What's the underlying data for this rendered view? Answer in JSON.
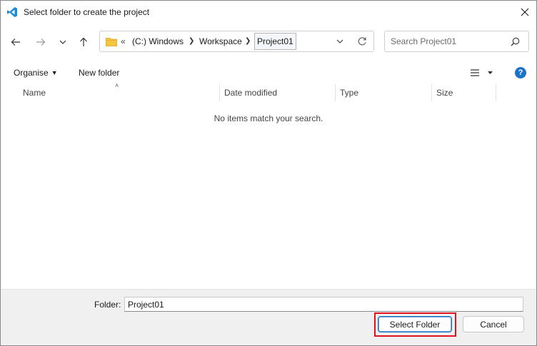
{
  "dialog": {
    "title": "Select folder to create the project"
  },
  "navigation": {
    "breadcrumb_lead": "«",
    "crumbs": [
      "(C:) Windows",
      "Workspace"
    ],
    "current": "Project01"
  },
  "search": {
    "placeholder": "Search Project01"
  },
  "commands": {
    "organise": "Organise",
    "new_folder": "New folder"
  },
  "columns": {
    "name": "Name",
    "date_modified": "Date modified",
    "type": "Type",
    "size": "Size"
  },
  "list": {
    "empty_message": "No items match your search."
  },
  "footer": {
    "folder_label": "Folder:",
    "folder_value": "Project01",
    "select_button": "Select Folder",
    "cancel_button": "Cancel"
  },
  "colors": {
    "accent": "#1a73c8",
    "highlight": "#e0141e",
    "footer_bg": "#f0f0f0"
  },
  "icons": [
    "vscode-icon",
    "close-icon",
    "back-arrow-icon",
    "forward-arrow-icon",
    "recent-dropdown-icon",
    "up-arrow-icon",
    "folder-icon",
    "chevron-down-icon",
    "refresh-icon",
    "search-icon",
    "view-options-icon",
    "help-icon"
  ]
}
